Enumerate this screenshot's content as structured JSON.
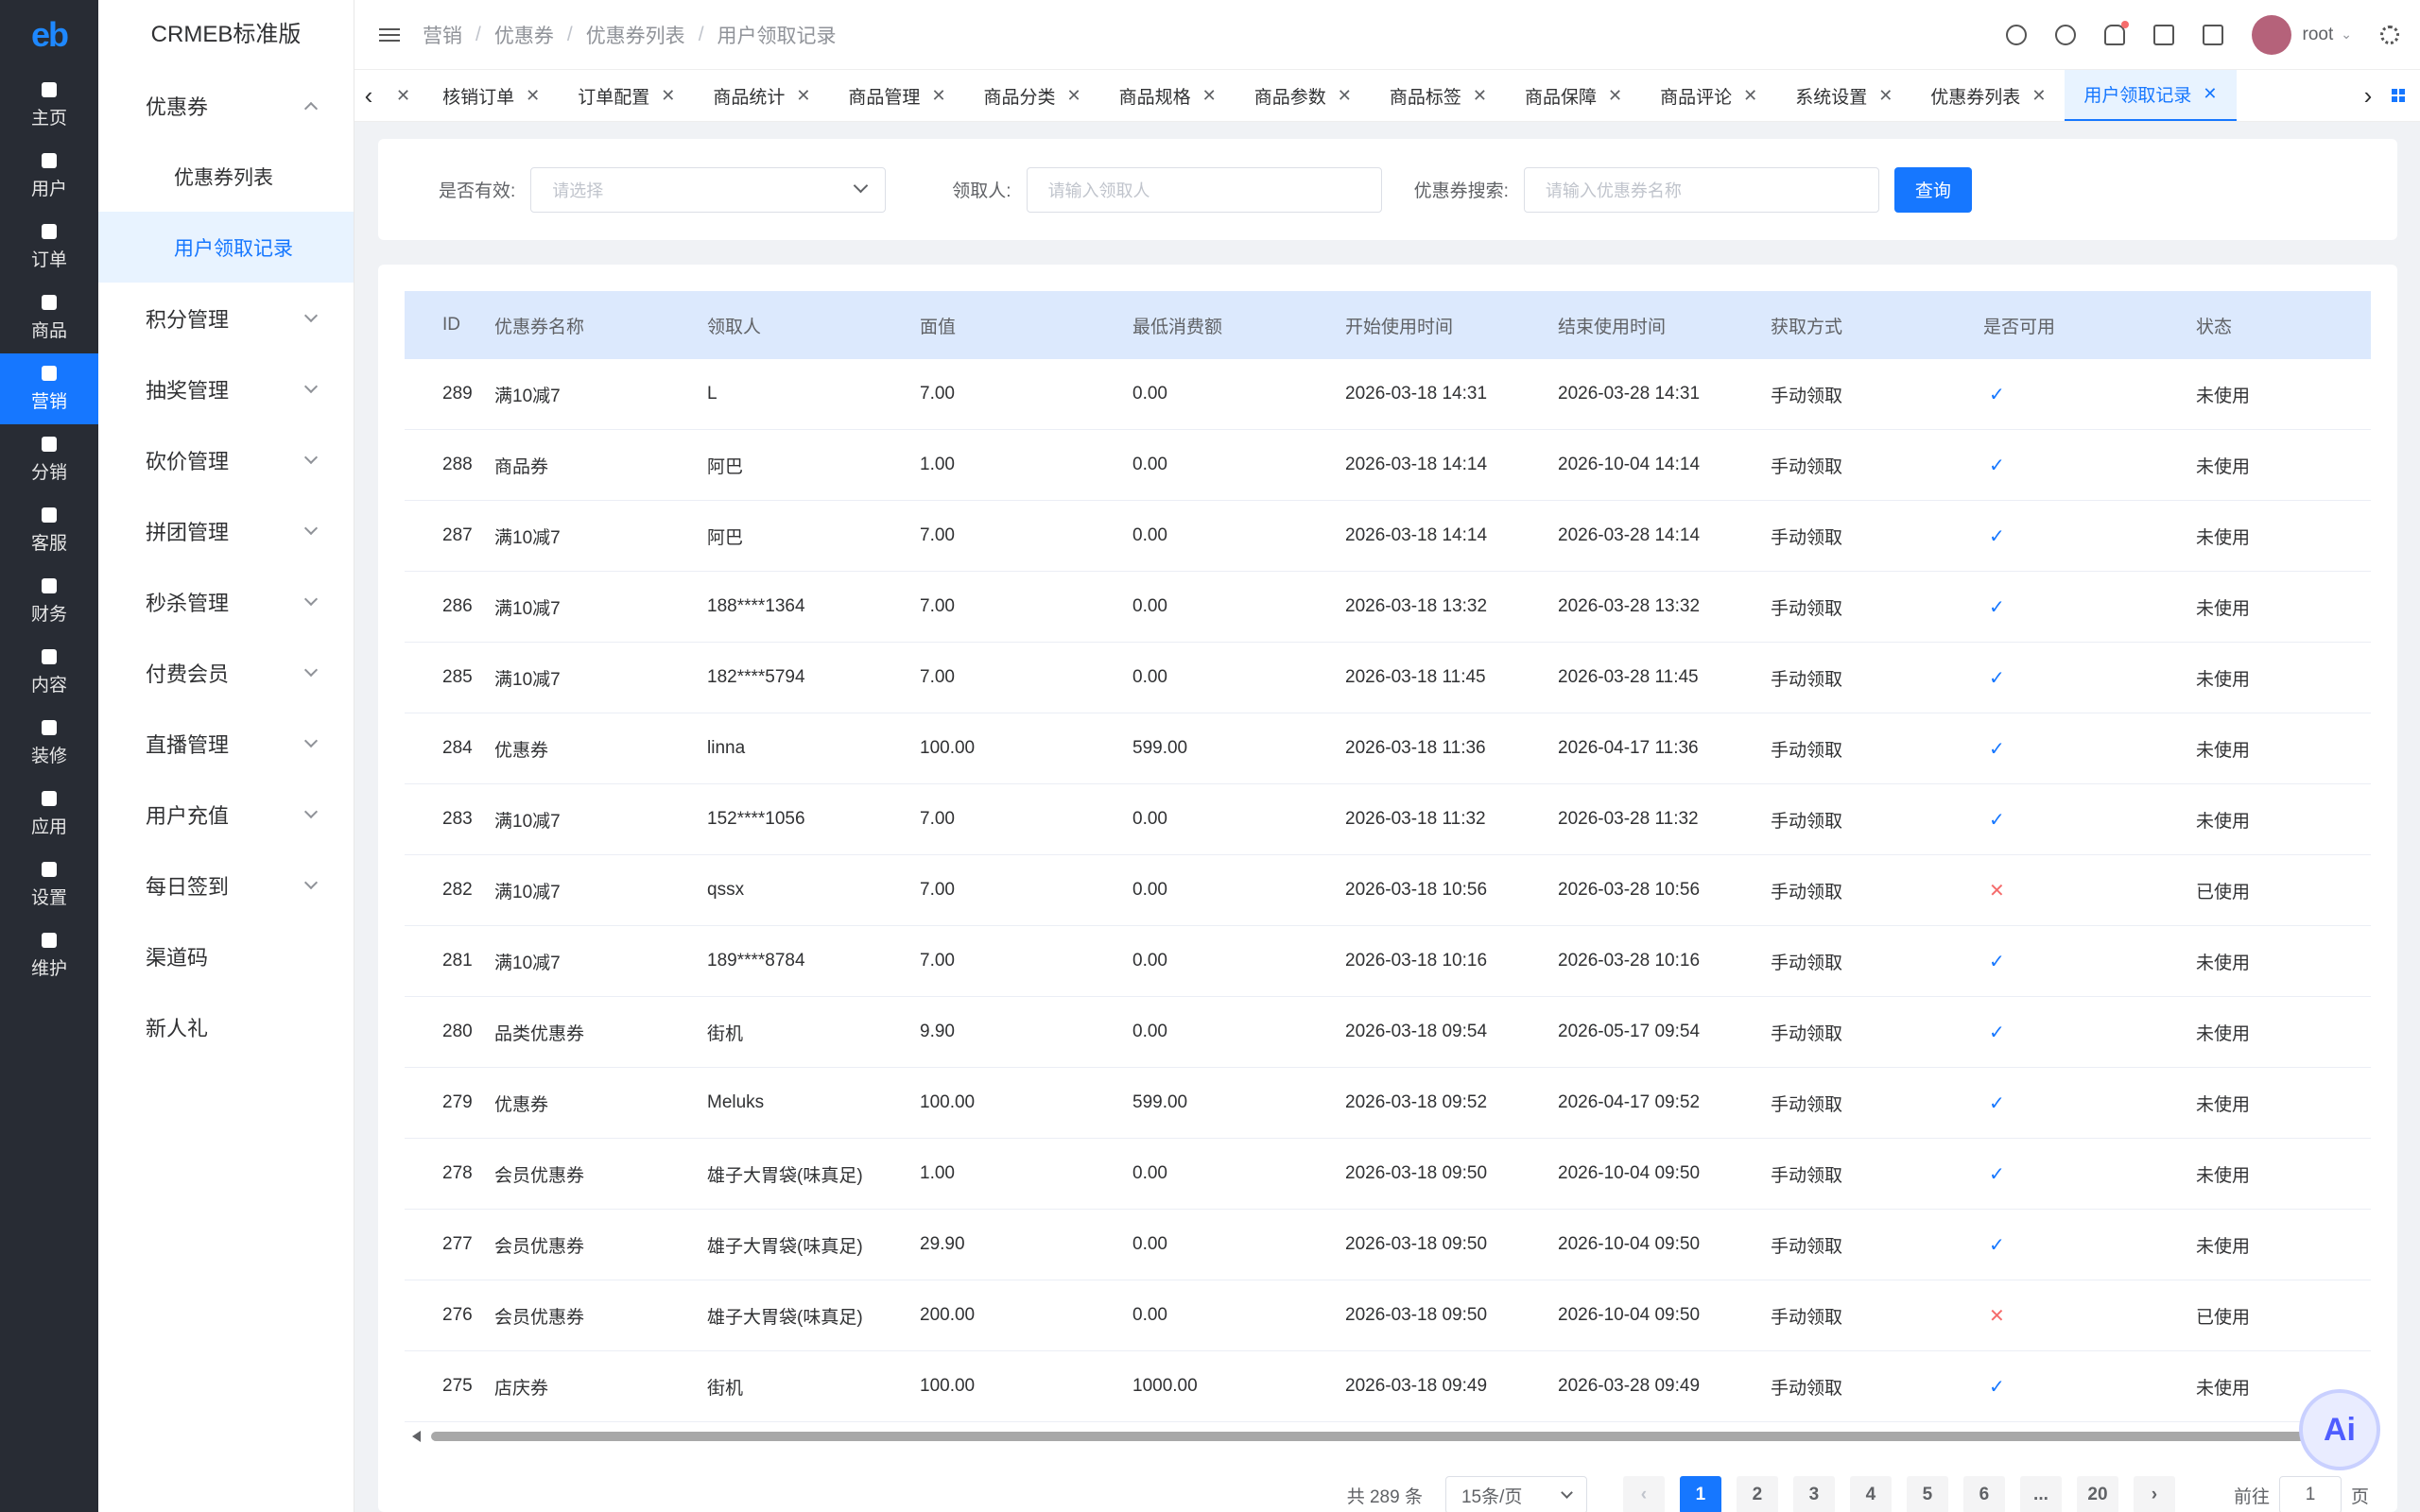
{
  "app": {
    "logo": "eb",
    "brand": "CRMEB标准版"
  },
  "rail": [
    {
      "label": "主页",
      "icon": "home-icon"
    },
    {
      "label": "用户",
      "icon": "user-icon"
    },
    {
      "label": "订单",
      "icon": "order-icon"
    },
    {
      "label": "商品",
      "icon": "product-icon"
    },
    {
      "label": "营销",
      "icon": "marketing-icon",
      "active": true
    },
    {
      "label": "分销",
      "icon": "distribution-icon"
    },
    {
      "label": "客服",
      "icon": "service-icon"
    },
    {
      "label": "财务",
      "icon": "finance-icon"
    },
    {
      "label": "内容",
      "icon": "content-icon"
    },
    {
      "label": "装修",
      "icon": "decorate-icon"
    },
    {
      "label": "应用",
      "icon": "apps-icon"
    },
    {
      "label": "设置",
      "icon": "settings-icon"
    },
    {
      "label": "维护",
      "icon": "maintain-icon"
    }
  ],
  "menu": {
    "coupon": "优惠券",
    "coupon_list": "优惠券列表",
    "user_records": "用户领取记录",
    "items": [
      "积分管理",
      "抽奖管理",
      "砍价管理",
      "拼团管理",
      "秒杀管理",
      "付费会员",
      "直播管理",
      "用户充值",
      "每日签到"
    ],
    "plain": [
      "渠道码",
      "新人礼"
    ]
  },
  "breadcrumb": [
    "营销",
    "优惠券",
    "优惠券列表",
    "用户领取记录"
  ],
  "header": {
    "user": "root"
  },
  "tabs": [
    "核销订单",
    "订单配置",
    "商品统计",
    "商品管理",
    "商品分类",
    "商品规格",
    "商品参数",
    "商品标签",
    "商品保障",
    "商品评论",
    "系统设置",
    "优惠券列表",
    "用户领取记录"
  ],
  "filter": {
    "valid_label": "是否有效:",
    "valid_placeholder": "请选择",
    "receiver_label": "领取人:",
    "receiver_placeholder": "请输入领取人",
    "coupon_label": "优惠券搜索:",
    "coupon_placeholder": "请输入优惠券名称",
    "query": "查询"
  },
  "table": {
    "columns": [
      "ID",
      "优惠券名称",
      "领取人",
      "面值",
      "最低消费额",
      "开始使用时间",
      "结束使用时间",
      "获取方式",
      "是否可用",
      "状态"
    ],
    "rows": [
      [
        "289",
        "满10减7",
        "L",
        "7.00",
        "0.00",
        "2026-03-18 14:31",
        "2026-03-28 14:31",
        "手动领取",
        "yes",
        "未使用"
      ],
      [
        "288",
        "商品券",
        "阿巴",
        "1.00",
        "0.00",
        "2026-03-18 14:14",
        "2026-10-04 14:14",
        "手动领取",
        "yes",
        "未使用"
      ],
      [
        "287",
        "满10减7",
        "阿巴",
        "7.00",
        "0.00",
        "2026-03-18 14:14",
        "2026-03-28 14:14",
        "手动领取",
        "yes",
        "未使用"
      ],
      [
        "286",
        "满10减7",
        "188****1364",
        "7.00",
        "0.00",
        "2026-03-18 13:32",
        "2026-03-28 13:32",
        "手动领取",
        "yes",
        "未使用"
      ],
      [
        "285",
        "满10减7",
        "182****5794",
        "7.00",
        "0.00",
        "2026-03-18 11:45",
        "2026-03-28 11:45",
        "手动领取",
        "yes",
        "未使用"
      ],
      [
        "284",
        "优惠券",
        "linna",
        "100.00",
        "599.00",
        "2026-03-18 11:36",
        "2026-04-17 11:36",
        "手动领取",
        "yes",
        "未使用"
      ],
      [
        "283",
        "满10减7",
        "152****1056",
        "7.00",
        "0.00",
        "2026-03-18 11:32",
        "2026-03-28 11:32",
        "手动领取",
        "yes",
        "未使用"
      ],
      [
        "282",
        "满10减7",
        "qssx",
        "7.00",
        "0.00",
        "2026-03-18 10:56",
        "2026-03-28 10:56",
        "手动领取",
        "no",
        "已使用"
      ],
      [
        "281",
        "满10减7",
        "189****8784",
        "7.00",
        "0.00",
        "2026-03-18 10:16",
        "2026-03-28 10:16",
        "手动领取",
        "yes",
        "未使用"
      ],
      [
        "280",
        "品类优惠券",
        "街机",
        "9.90",
        "0.00",
        "2026-03-18 09:54",
        "2026-05-17 09:54",
        "手动领取",
        "yes",
        "未使用"
      ],
      [
        "279",
        "优惠券",
        "Meluks",
        "100.00",
        "599.00",
        "2026-03-18 09:52",
        "2026-04-17 09:52",
        "手动领取",
        "yes",
        "未使用"
      ],
      [
        "278",
        "会员优惠券",
        "雄子大胃袋(味真足)",
        "1.00",
        "0.00",
        "2026-03-18 09:50",
        "2026-10-04 09:50",
        "手动领取",
        "yes",
        "未使用"
      ],
      [
        "277",
        "会员优惠券",
        "雄子大胃袋(味真足)",
        "29.90",
        "0.00",
        "2026-03-18 09:50",
        "2026-10-04 09:50",
        "手动领取",
        "yes",
        "未使用"
      ],
      [
        "276",
        "会员优惠券",
        "雄子大胃袋(味真足)",
        "200.00",
        "0.00",
        "2026-03-18 09:50",
        "2026-10-04 09:50",
        "手动领取",
        "no",
        "已使用"
      ],
      [
        "275",
        "店庆券",
        "街机",
        "100.00",
        "1000.00",
        "2026-03-18 09:49",
        "2026-03-28 09:49",
        "手动领取",
        "yes",
        "未使用"
      ]
    ]
  },
  "pagination": {
    "total": "共 289 条",
    "page_size": "15条/页",
    "pages": [
      "1",
      "2",
      "3",
      "4",
      "5",
      "6",
      "...",
      "20"
    ],
    "current": "1",
    "goto": "前往",
    "goto_value": "1",
    "page_unit": "页"
  },
  "ai": {
    "label": "Ai"
  },
  "colors": {
    "primary": "#1677ff",
    "rail": "#282c34",
    "danger": "#f56c6c"
  }
}
